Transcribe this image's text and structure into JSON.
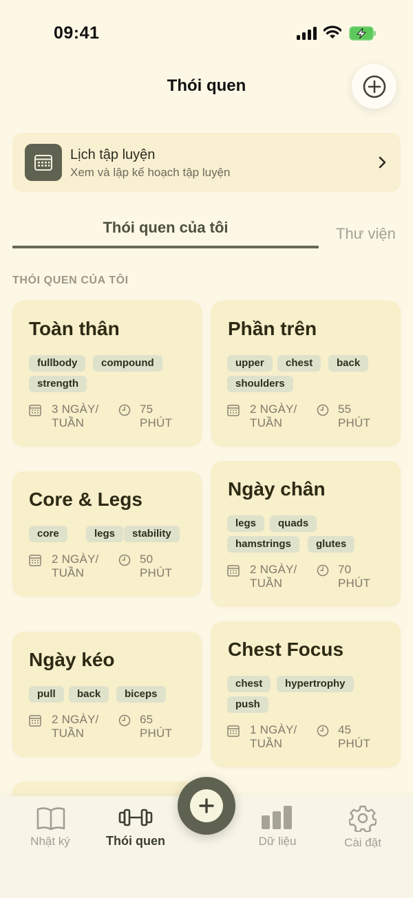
{
  "status": {
    "time": "09:41"
  },
  "header": {
    "title": "Thói quen"
  },
  "schedule": {
    "title": "Lịch tập luyện",
    "subtitle": "Xem và lập kế hoạch tập luyện"
  },
  "tabs": [
    {
      "label": "Thói quen của tôi",
      "active": true
    },
    {
      "label": "Thư viện",
      "active": false
    }
  ],
  "section_label": "THÓI QUEN CỦA TÔI",
  "routines": [
    {
      "title": "Toàn thân",
      "tags": [
        "fullbody",
        "compound",
        "strength"
      ],
      "days": "3 NGÀY/",
      "days_unit": "TUẦN",
      "minutes": "75",
      "minutes_unit": "PHÚT"
    },
    {
      "title": "Phần trên",
      "tags": [
        "upper",
        "chest",
        "back",
        "shoulders"
      ],
      "days": "2 NGÀY/",
      "days_unit": "TUẦN",
      "minutes": "55",
      "minutes_unit": "PHÚT"
    },
    {
      "title": "Core & Legs",
      "tags": [
        "core",
        "legs",
        "stability"
      ],
      "days": "2 NGÀY/",
      "days_unit": "TUẦN",
      "minutes": "50",
      "minutes_unit": "PHÚT"
    },
    {
      "title": "Ngày chân",
      "tags": [
        "legs",
        "quads",
        "hamstrings",
        "glutes"
      ],
      "days": "2 NGÀY/",
      "days_unit": "TUẦN",
      "minutes": "70",
      "minutes_unit": "PHÚT"
    },
    {
      "title": "Ngày kéo",
      "tags": [
        "pull",
        "back",
        "biceps"
      ],
      "days": "2 NGÀY/",
      "days_unit": "TUẦN",
      "minutes": "65",
      "minutes_unit": "PHÚT"
    },
    {
      "title": "Chest Focus",
      "tags": [
        "chest",
        "hypertrophy",
        "push"
      ],
      "days": "1 NGÀY/",
      "days_unit": "TUẦN",
      "minutes": "45",
      "minutes_unit": "PHÚT"
    }
  ],
  "nav": [
    {
      "label": "Nhật ký",
      "icon": "book-icon",
      "active": false
    },
    {
      "label": "Thói quen",
      "icon": "dumbbell-icon",
      "active": true
    },
    {
      "label": "Dữ liệu",
      "icon": "bar-chart-icon",
      "active": false
    },
    {
      "label": "Cài đặt",
      "icon": "gear-icon",
      "active": false
    }
  ],
  "colors": {
    "background": "#fdf8e6",
    "card": "#f8efcb",
    "accent": "#5f6250",
    "tag": "#dfe2cb"
  }
}
